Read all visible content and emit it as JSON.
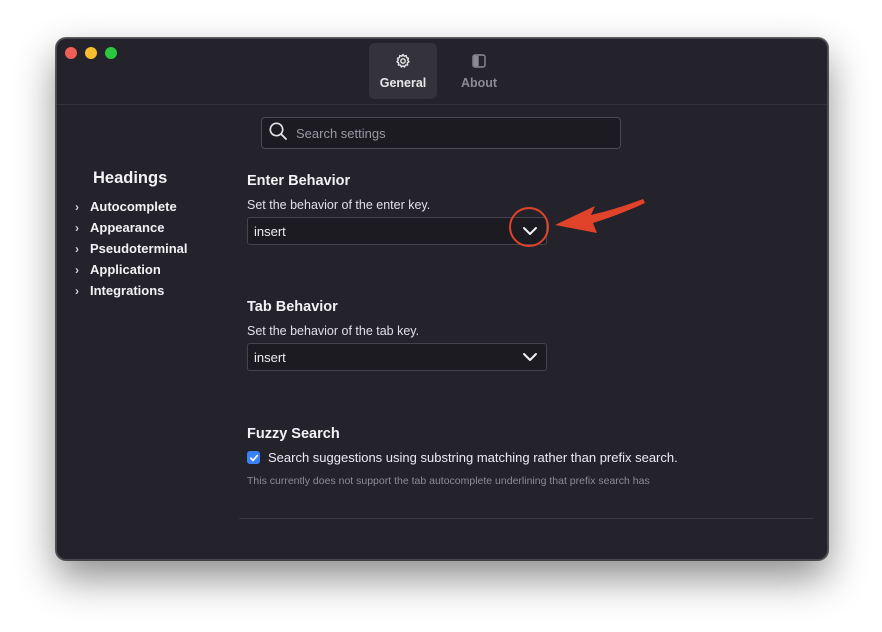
{
  "window": {
    "tabs": [
      {
        "label": "General",
        "icon": "gear-icon",
        "selected": true
      },
      {
        "label": "About",
        "icon": "sidebar-icon",
        "selected": false
      }
    ]
  },
  "search": {
    "placeholder": "Search settings",
    "value": ""
  },
  "sidebar": {
    "title": "Headings",
    "items": [
      {
        "label": "Autocomplete"
      },
      {
        "label": "Appearance"
      },
      {
        "label": "Pseudoterminal"
      },
      {
        "label": "Application"
      },
      {
        "label": "Integrations"
      }
    ]
  },
  "settings": {
    "enter": {
      "title": "Enter Behavior",
      "description": "Set the behavior of the enter key.",
      "value": "insert"
    },
    "tab": {
      "title": "Tab Behavior",
      "description": "Set the behavior of the tab key.",
      "value": "insert"
    },
    "fuzzy": {
      "title": "Fuzzy Search",
      "checkbox_label": "Search suggestions using substring matching rather than prefix search.",
      "checked": true,
      "note": "This currently does not support the tab autocomplete underlining that prefix search has"
    }
  },
  "colors": {
    "window_bg": "#24232c",
    "accent": "#3a82f7",
    "annotation": "#e0432a"
  }
}
